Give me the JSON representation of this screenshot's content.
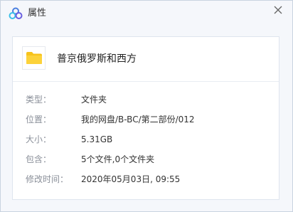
{
  "window": {
    "title": "属性",
    "logo_icon": "cloud-logo-icon",
    "close_icon": "close-icon"
  },
  "file": {
    "name": "普京俄罗斯和西方",
    "icon": "folder-icon",
    "icon_color": "#f7c31b"
  },
  "properties": [
    {
      "label": "类型：",
      "value": "文件夹"
    },
    {
      "label": "位置：",
      "value": "我的网盘/B-BC/第二部份/012"
    },
    {
      "label": "大小：",
      "value": "5.31GB"
    },
    {
      "label": "包含：",
      "value": "5个文件,0个文件夹"
    },
    {
      "label": "修改时间：",
      "value": "2020年05月03日, 09:55"
    }
  ],
  "colors": {
    "accent": "#3a7bd5",
    "label": "#8a8f99",
    "value": "#333333"
  }
}
